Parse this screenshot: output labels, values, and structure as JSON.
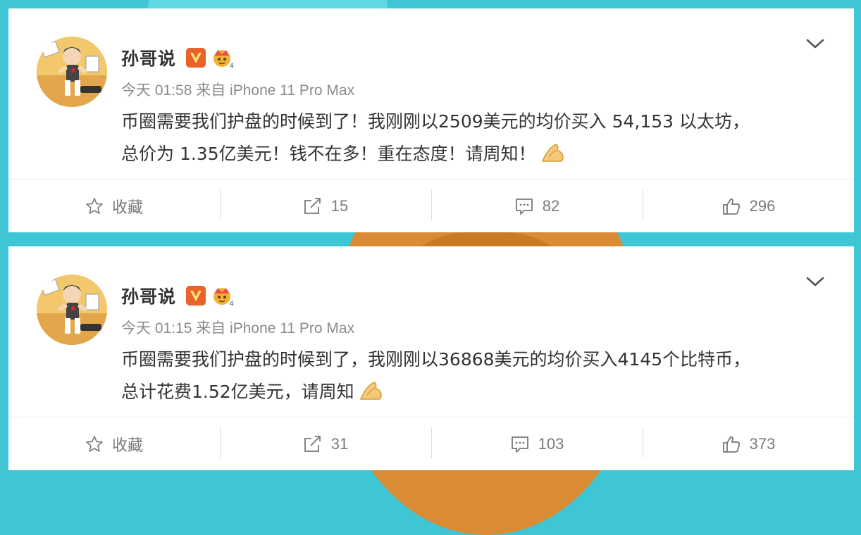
{
  "posts": [
    {
      "author": "孙哥说",
      "meta": "今天 01:58 来自 iPhone 11 Pro Max",
      "text_line1": "币圈需要我们护盘的时候到了！我刚刚以2509美元的均价买入 54,153 以太坊，",
      "text_line2": "总价为 1.35亿美元！钱不在多！重在态度！请周知！",
      "actions": {
        "favorite_label": "收藏",
        "repost_count": "15",
        "comment_count": "82",
        "like_count": "296"
      }
    },
    {
      "author": "孙哥说",
      "meta": "今天 01:15 来自 iPhone 11 Pro Max",
      "text_line1": "币圈需要我们护盘的时候到了，我刚刚以36868美元的均价买入4145个比特币，",
      "text_line2": "总计花费1.52亿美元，请周知",
      "actions": {
        "favorite_label": "收藏",
        "repost_count": "31",
        "comment_count": "103",
        "like_count": "373"
      }
    }
  ],
  "colors": {
    "background": "#3fc6d5",
    "card": "#ffffff",
    "verified_badge": "#e8622a",
    "meta_text": "#8b8b8b"
  },
  "icons": [
    "chevron-down-icon",
    "verified-v-icon",
    "vip-crown-icon",
    "star-icon",
    "repost-icon",
    "comment-icon",
    "thumbs-up-icon",
    "folded-hands-emoji"
  ]
}
